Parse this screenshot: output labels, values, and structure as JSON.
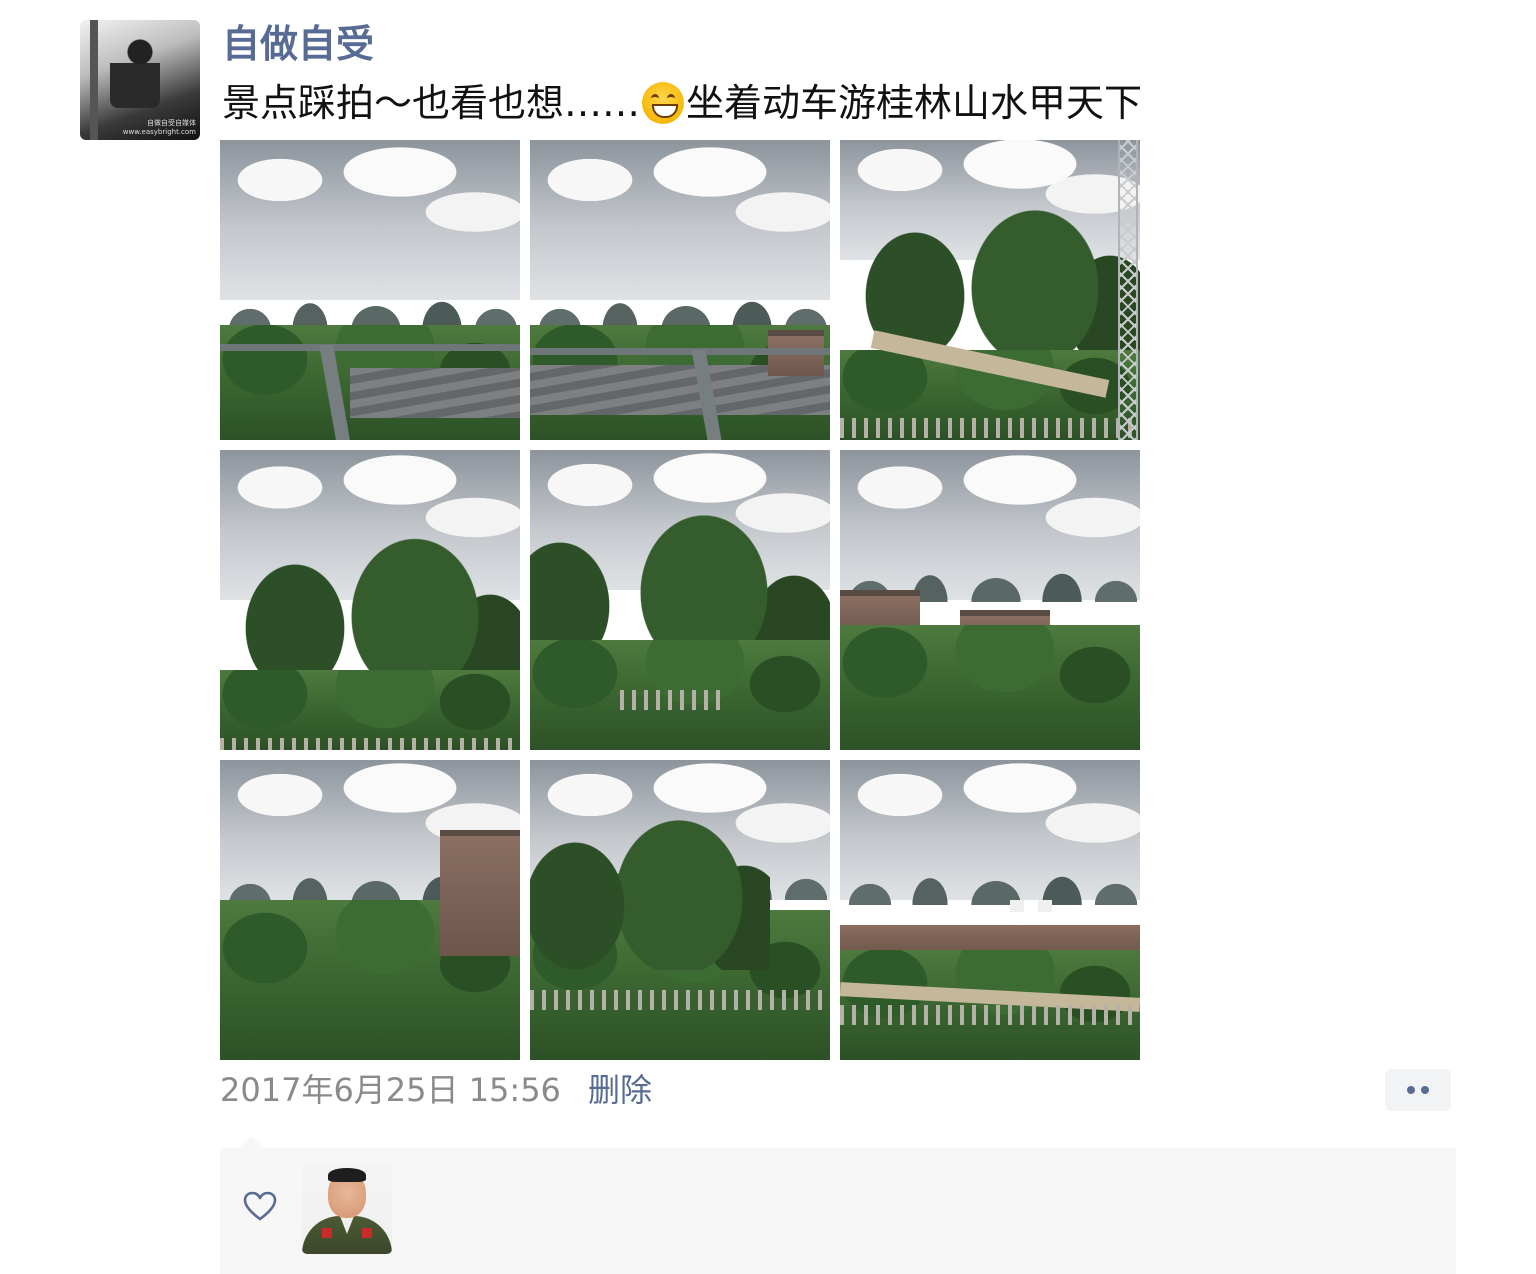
{
  "post": {
    "username": "自做自受",
    "text_before_emoji": "景点踩拍～也看也想……",
    "text_after_emoji": "坐着动车游桂林山水甲天下",
    "emoji": "grinning-face-emoji",
    "timestamp": "2017年6月25日 15:56",
    "delete_label": "删除",
    "more_button_icon": "two-dots-icon",
    "avatar_caption_line1": "自做自受自媒体",
    "avatar_caption_line2": "www.easybright.com",
    "photos": [
      "photo-1",
      "photo-2",
      "photo-3",
      "photo-4",
      "photo-5",
      "photo-6",
      "photo-7",
      "photo-8",
      "photo-9"
    ]
  },
  "likes": {
    "icon": "heart-icon",
    "likers": [
      "liker-avatar-1"
    ]
  },
  "colors": {
    "link": "#576b95",
    "text": "#111111",
    "timestamp": "#8a8a8a",
    "likes_bg": "#f7f7f7",
    "more_bg": "#f2f3f5"
  }
}
